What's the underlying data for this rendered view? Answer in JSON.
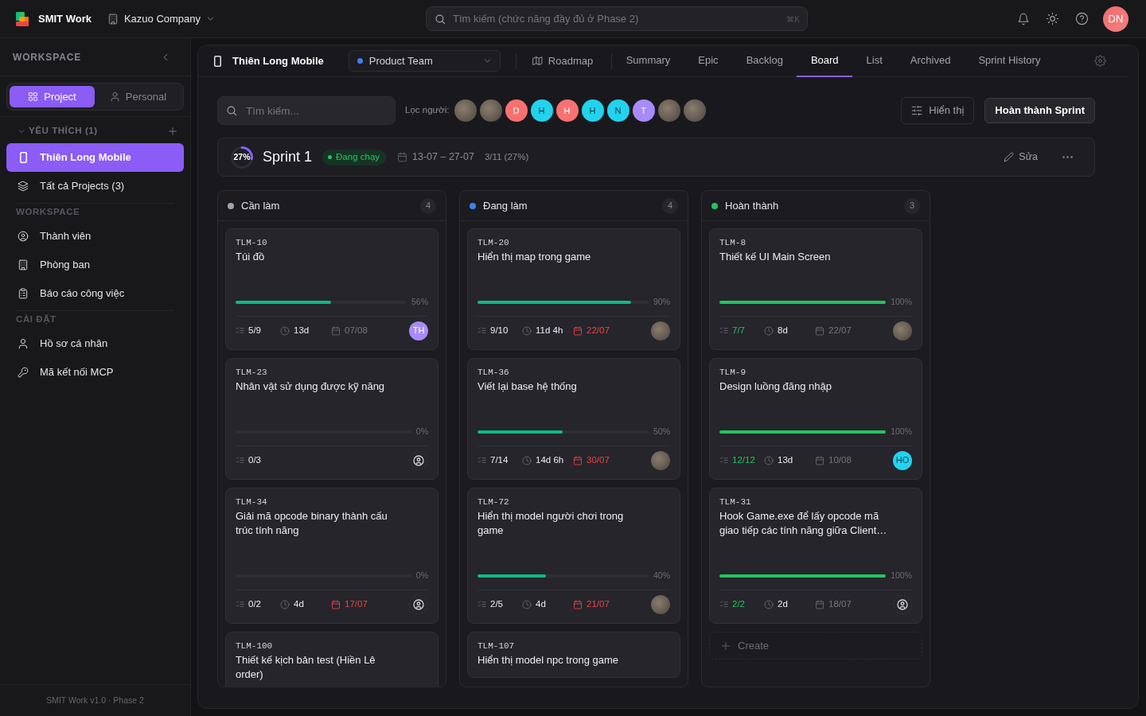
{
  "topbar": {
    "app_name": "SMIT Work",
    "company": "Kazuo Company",
    "search": {
      "placeholder": "Tìm kiếm (chức năng đầy đủ ở Phase 2)",
      "shortcut": "⌘K"
    },
    "user": {
      "initials": "DN"
    }
  },
  "sidebar": {
    "heading": "WORKSPACE",
    "modes": [
      {
        "label": "Project",
        "selected": true
      },
      {
        "label": "Personal",
        "selected": false
      }
    ],
    "favorites": {
      "title": "YÊU THÍCH (1)",
      "expanded": true,
      "items": [
        {
          "label": "Thiên Long Mobile",
          "selected": true
        }
      ]
    },
    "all_projects": {
      "label": "Tất cả Projects (3)",
      "selected": false
    },
    "sections": [
      {
        "title": "WORKSPACE",
        "items": [
          {
            "label": "Thành viên",
            "selected": false
          },
          {
            "label": "Phòng ban",
            "selected": false
          },
          {
            "label": "Báo cáo công việc",
            "selected": false
          }
        ]
      },
      {
        "title": "CÀI ĐẶT",
        "items": [
          {
            "label": "Hồ sơ cá nhân",
            "selected": false
          },
          {
            "label": "Mã kết nối MCP",
            "selected": false
          }
        ]
      }
    ],
    "footer": "SMIT Work v1.0 · Phase 2"
  },
  "project": {
    "name": "Thiên Long Mobile",
    "team": "Product Team",
    "roadmap": "Roadmap",
    "tabs": [
      {
        "label": "Summary",
        "selected": false
      },
      {
        "label": "Epic",
        "selected": false
      },
      {
        "label": "Backlog",
        "selected": false
      },
      {
        "label": "Board",
        "selected": true
      },
      {
        "label": "List",
        "selected": false
      },
      {
        "label": "Archived",
        "selected": false
      },
      {
        "label": "Sprint History",
        "selected": false
      }
    ]
  },
  "toolbar": {
    "search": {
      "placeholder": "Tìm kiếm..."
    },
    "filter_label": "Lọc người:",
    "people": [
      {
        "kind": "photo"
      },
      {
        "kind": "photo"
      },
      {
        "kind": "initials",
        "initials": "D",
        "color": "#f87171"
      },
      {
        "kind": "initials",
        "initials": "H",
        "color": "#22d3ee"
      },
      {
        "kind": "initials",
        "initials": "H",
        "color": "#f87171"
      },
      {
        "kind": "initials",
        "initials": "H",
        "color": "#22d3ee"
      },
      {
        "kind": "initials",
        "initials": "N",
        "color": "#22d3ee"
      },
      {
        "kind": "initials",
        "initials": "T",
        "color": "#a78bfa"
      },
      {
        "kind": "photo"
      },
      {
        "kind": "photo"
      }
    ],
    "display_button": "Hiển thị",
    "complete_button": "Hoàn thành Sprint"
  },
  "sprint": {
    "level": 0.27,
    "percent": "27%",
    "name": "Sprint 1",
    "status": "Đang chạy",
    "dates": "13-07 – 27-07",
    "progress": "3/11 (27%)",
    "edit": "Sửa"
  },
  "columns": [
    {
      "title": "Cần làm",
      "color": "#9ca3af",
      "count": "4",
      "cards": [
        {
          "id": "TLM-10",
          "title": "Túi đồ",
          "level": 0.56,
          "percent": "56%",
          "subtasks": "5/9",
          "subtasks_complete": false,
          "time": "13d",
          "due": "07/08",
          "overdue": false,
          "assignee": {
            "kind": "initials",
            "initials": "TH",
            "color": "#a78bfa"
          }
        },
        {
          "id": "TLM-23",
          "title": "Nhân vật sử dụng được kỹ năng",
          "level": 0,
          "percent": "0%",
          "subtasks": "0/3",
          "subtasks_complete": false,
          "assignee": {
            "kind": "none"
          }
        },
        {
          "id": "TLM-34",
          "title": "Giải mã opcode binary thành cấu trúc tính năng",
          "level": 0,
          "percent": "0%",
          "subtasks": "0/2",
          "subtasks_complete": false,
          "time": "4d",
          "due": "17/07",
          "overdue": true,
          "assignee": {
            "kind": "none"
          }
        },
        {
          "id": "TLM-100",
          "title": "Thiết kế kịch bản test (Hiền Lê order)"
        }
      ]
    },
    {
      "title": "Đang làm",
      "color": "#3b82f6",
      "count": "4",
      "cards": [
        {
          "id": "TLM-20",
          "title": "Hiển thị map trong game",
          "level": 0.9,
          "percent": "90%",
          "subtasks": "9/10",
          "subtasks_complete": false,
          "time": "11d 4h",
          "due": "22/07",
          "overdue": true,
          "assignee": {
            "kind": "photo"
          }
        },
        {
          "id": "TLM-36",
          "title": "Viết lại base hệ thống",
          "level": 0.5,
          "percent": "50%",
          "subtasks": "7/14",
          "subtasks_complete": false,
          "time": "14d 6h",
          "due": "30/07",
          "overdue": true,
          "assignee": {
            "kind": "photo"
          }
        },
        {
          "id": "TLM-72",
          "title": "Hiển thị model người chơi trong game",
          "level": 0.4,
          "percent": "40%",
          "subtasks": "2/5",
          "subtasks_complete": false,
          "time": "4d",
          "due": "21/07",
          "overdue": true,
          "assignee": {
            "kind": "photo"
          }
        },
        {
          "id": "TLM-107",
          "title": "Hiển thị model npc trong game"
        }
      ]
    },
    {
      "title": "Hoàn thành",
      "color": "#22c55e",
      "count": "3",
      "cards": [
        {
          "id": "TLM-8",
          "title": "Thiết kế UI Main Screen",
          "level": 1,
          "percent": "100%",
          "subtasks": "7/7",
          "subtasks_complete": true,
          "time": "8d",
          "due": "22/07",
          "overdue": false,
          "assignee": {
            "kind": "photo"
          }
        },
        {
          "id": "TLM-9",
          "title": "Design luồng đăng nhập",
          "level": 1,
          "percent": "100%",
          "subtasks": "12/12",
          "subtasks_complete": true,
          "time": "13d",
          "due": "10/08",
          "overdue": false,
          "assignee": {
            "kind": "initials",
            "initials": "HO",
            "color": "#22d3ee"
          }
        },
        {
          "id": "TLM-31",
          "title": "Hook Game.exe để lấy opcode mã giao tiếp các tính năng giữa Client…",
          "level": 1,
          "percent": "100%",
          "subtasks": "2/2",
          "subtasks_complete": true,
          "time": "2d",
          "due": "18/07",
          "overdue": false,
          "assignee": {
            "kind": "none"
          }
        }
      ],
      "create_label": "Create"
    }
  ]
}
